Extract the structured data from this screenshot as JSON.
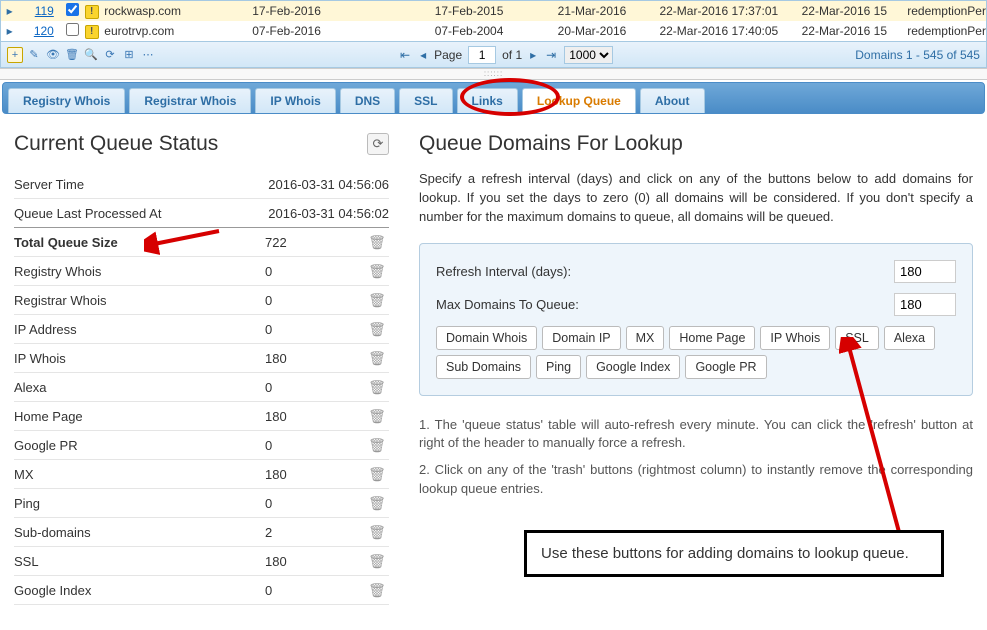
{
  "grid": {
    "rows": [
      {
        "id": "119",
        "checked": true,
        "domain": "rockwasp.com",
        "date1": "17-Feb-2016",
        "date2": "17-Feb-2015",
        "date3": "21-Mar-2016",
        "date4": "22-Mar-2016 17:37:01",
        "date5": "22-Mar-2016 15",
        "status": "redemptionPer",
        "highlighted": true
      },
      {
        "id": "120",
        "checked": false,
        "domain": "eurotrvp.com",
        "date1": "07-Feb-2016",
        "date2": "07-Feb-2004",
        "date3": "20-Mar-2016",
        "date4": "22-Mar-2016 17:40:05",
        "date5": "22-Mar-2016 15",
        "status": "redemptionPer",
        "highlighted": false
      }
    ]
  },
  "toolbar": {
    "page_label_pre": "Page",
    "page_value": "1",
    "page_label_post": "of 1",
    "page_size": "1000",
    "count_text": "Domains 1 - 545 of 545"
  },
  "tabs": [
    {
      "key": "registry-whois",
      "label": "Registry Whois"
    },
    {
      "key": "registrar-whois",
      "label": "Registrar Whois"
    },
    {
      "key": "ip-whois",
      "label": "IP Whois"
    },
    {
      "key": "dns",
      "label": "DNS"
    },
    {
      "key": "ssl",
      "label": "SSL"
    },
    {
      "key": "links",
      "label": "Links"
    },
    {
      "key": "lookup-queue",
      "label": "Lookup Queue",
      "active": true
    },
    {
      "key": "about",
      "label": "About"
    }
  ],
  "queue_status": {
    "title": "Current Queue Status",
    "server_time_label": "Server Time",
    "server_time_value": "2016-03-31 04:56:06",
    "processed_label": "Queue Last Processed At",
    "processed_value": "2016-03-31 04:56:02",
    "total_label": "Total Queue Size",
    "total_value": "722",
    "items": [
      {
        "label": "Registry Whois",
        "value": "0"
      },
      {
        "label": "Registrar Whois",
        "value": "0"
      },
      {
        "label": "IP Address",
        "value": "0"
      },
      {
        "label": "IP Whois",
        "value": "180"
      },
      {
        "label": "Alexa",
        "value": "0"
      },
      {
        "label": "Home Page",
        "value": "180"
      },
      {
        "label": "Google PR",
        "value": "0"
      },
      {
        "label": "MX",
        "value": "180"
      },
      {
        "label": "Ping",
        "value": "0"
      },
      {
        "label": "Sub-domains",
        "value": "2"
      },
      {
        "label": "SSL",
        "value": "180"
      },
      {
        "label": "Google Index",
        "value": "0"
      }
    ]
  },
  "lookup": {
    "title": "Queue Domains For Lookup",
    "intro": "Specify a refresh interval (days) and click on any of the buttons below to add domains for lookup. If you set the days to zero (0) all domains will be considered. If you don't specify a number for the maximum domains to queue, all domains will be queued.",
    "refresh_label": "Refresh Interval (days):",
    "refresh_value": "180",
    "max_label": "Max Domains To Queue:",
    "max_value": "180",
    "buttons": [
      "Domain Whois",
      "Domain IP",
      "MX",
      "Home Page",
      "IP Whois",
      "SSL",
      "Alexa",
      "Sub Domains",
      "Ping",
      "Google Index",
      "Google PR"
    ],
    "note1": "1. The 'queue status' table will auto-refresh every minute. You can click the 'refresh' button at right of the header to manually force a refresh.",
    "note2": "2. Click on any of the 'trash' buttons (rightmost column) to instantly remove the corresponding lookup queue entries.",
    "callout": "Use these buttons for adding domains to lookup queue."
  }
}
